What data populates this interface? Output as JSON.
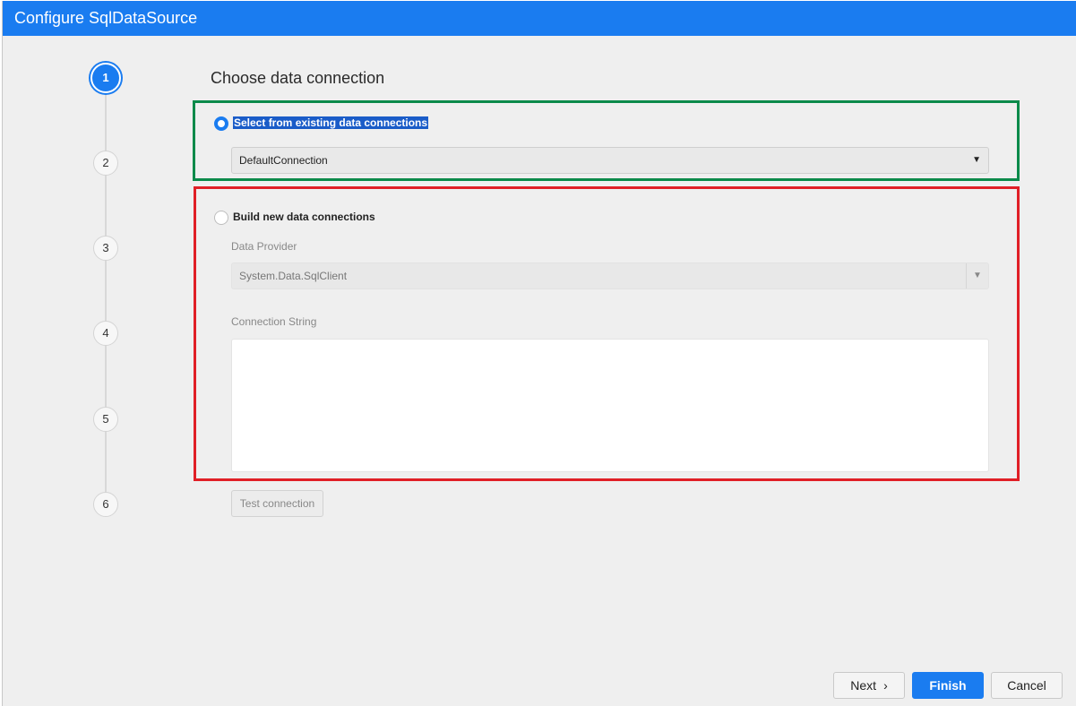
{
  "window": {
    "title": "Configure SqlDataSource"
  },
  "stepper": {
    "steps": [
      "1",
      "2",
      "3",
      "4",
      "5",
      "6"
    ],
    "active_step": 1
  },
  "page": {
    "heading": "Choose data connection"
  },
  "existing": {
    "radio_label": "Select from existing data connections",
    "selected": true,
    "connection_value": "DefaultConnection"
  },
  "build_new": {
    "radio_label": "Build new data connections",
    "selected": false,
    "provider_label": "Data Provider",
    "provider_value": "System.Data.SqlClient",
    "connection_string_label": "Connection String",
    "connection_string_value": "",
    "test_button": "Test connection"
  },
  "footer": {
    "next": "Next",
    "finish": "Finish",
    "cancel": "Cancel"
  },
  "colors": {
    "accent": "#1a7cf0",
    "highlight_green": "#0b8a4a",
    "highlight_red": "#e01f26"
  }
}
